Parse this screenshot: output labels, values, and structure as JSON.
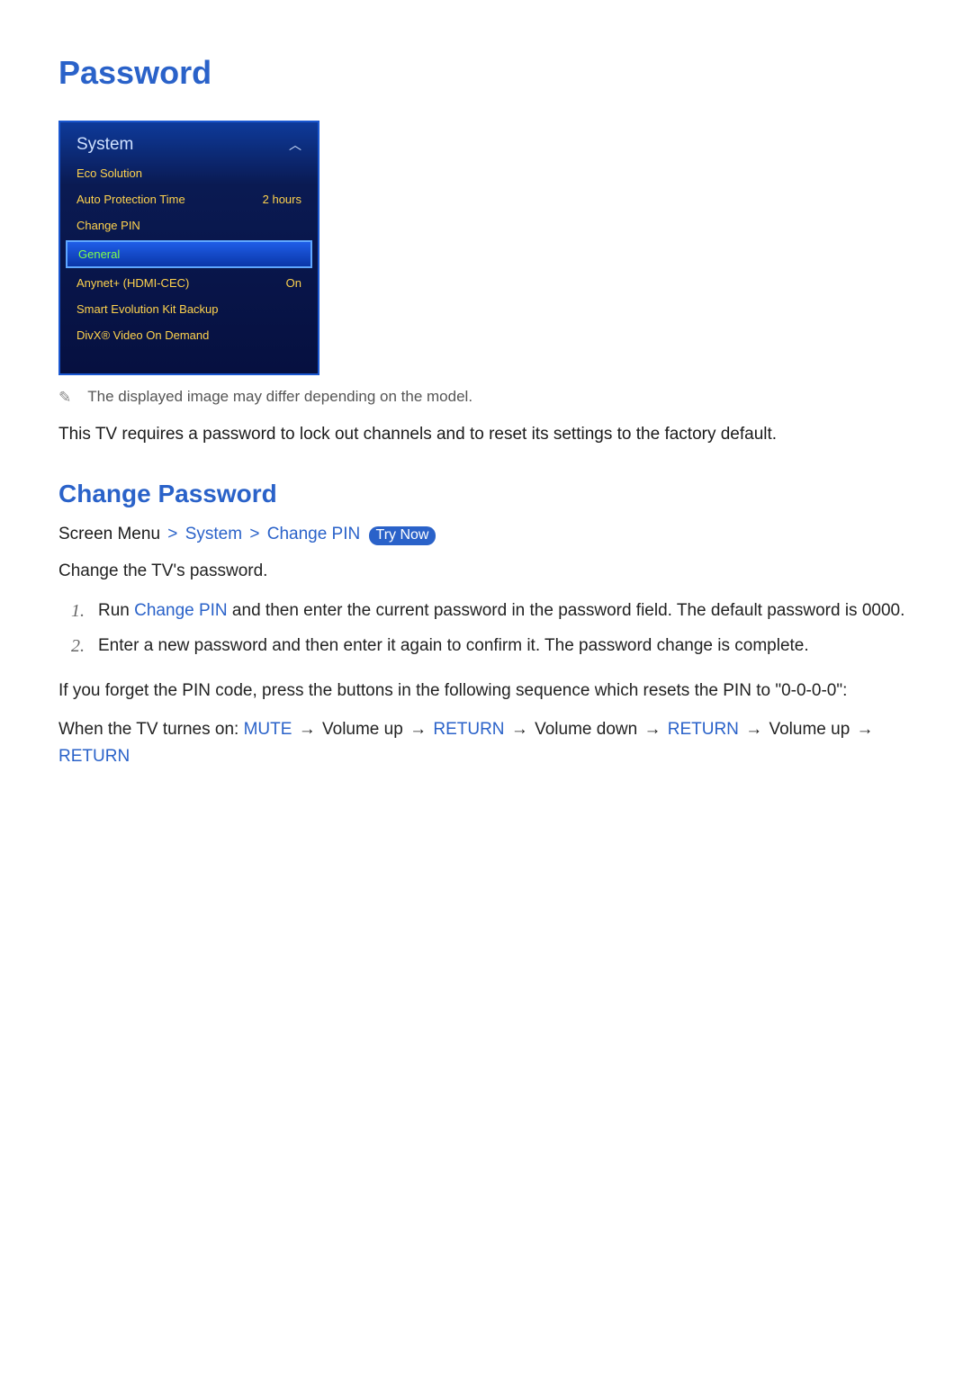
{
  "page_title": "Password",
  "menu": {
    "header": "System",
    "items": [
      {
        "label": "Eco Solution",
        "value": ""
      },
      {
        "label": "Auto Protection Time",
        "value": "2 hours"
      },
      {
        "label": "Change PIN",
        "value": ""
      },
      {
        "label": "General",
        "value": "",
        "highlight": true
      },
      {
        "label": "Anynet+ (HDMI-CEC)",
        "value": "On"
      },
      {
        "label": "Smart Evolution Kit Backup",
        "value": ""
      },
      {
        "label": "DivX® Video On Demand",
        "value": ""
      }
    ]
  },
  "image_note": "The displayed image may differ depending on the model.",
  "intro": "This TV requires a password to lock out channels and to reset its settings to the factory default.",
  "section_title": "Change Password",
  "breadcrumb": {
    "prefix": "Screen Menu",
    "path": [
      "System",
      "Change PIN"
    ],
    "try_now": "Try Now",
    "sep": ">"
  },
  "change_intro": "Change the TV's password.",
  "steps": {
    "s1_pre": "Run ",
    "s1_blue": "Change PIN",
    "s1_post": " and then enter the current password in the password field. The default password is 0000.",
    "s2": "Enter a new password and then enter it again to confirm it. The password change is complete."
  },
  "forgot": "If you forget the PIN code, press the buttons in the following sequence which resets the PIN to \"0-0-0-0\":",
  "reset": {
    "prefix": "When the TV turnes on: ",
    "seq": [
      "MUTE",
      "Volume up",
      "RETURN",
      "Volume down",
      "RETURN",
      "Volume up",
      "RETURN"
    ],
    "arrow": "→"
  }
}
